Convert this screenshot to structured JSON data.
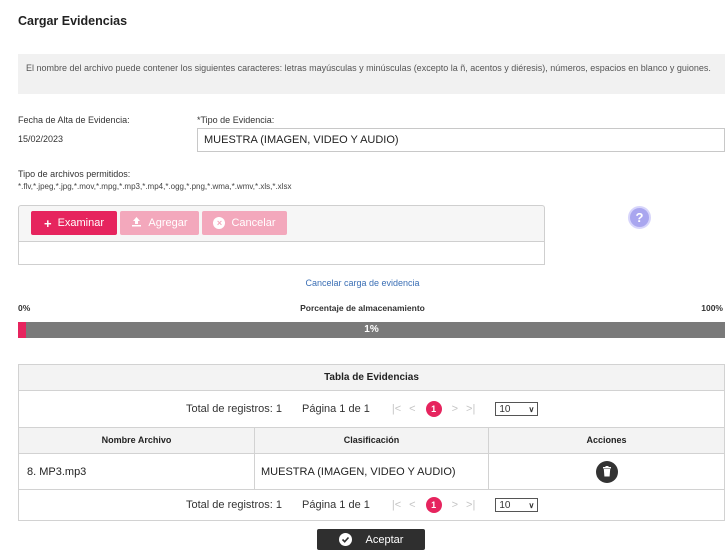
{
  "title": "Cargar Evidencias",
  "info_text": "El nombre del archivo puede contener los siguientes caracteres: letras mayúsculas y minúsculas (excepto la ñ, acentos y diéresis), números, espacios en blanco y guiones.",
  "fecha": {
    "label": "Fecha de Alta de Evidencia:",
    "value": "15/02/2023"
  },
  "tipo": {
    "label": "*Tipo de Evidencia:",
    "value": "MUESTRA (IMAGEN, VIDEO Y AUDIO)"
  },
  "allowed": {
    "label": "Tipo de archivos permitidos:",
    "value": "*.flv,*.jpeg,*.jpg,*.mov,*.mpg,*.mp3,*.mp4,*.ogg,*.png,*.wma,*.wmv,*.xls,*.xlsx"
  },
  "buttons": {
    "examinar": "Examinar",
    "agregar": "Agregar",
    "cancelar": "Cancelar",
    "aceptar": "Aceptar"
  },
  "icons": {
    "help": "?"
  },
  "cancel_link": "Cancelar carga de evidencia",
  "storage": {
    "left": "0%",
    "label": "Porcentaje de almacenamiento",
    "right": "100%",
    "percent_text": "1%",
    "fill_fraction": 0.012
  },
  "table": {
    "title": "Tabla de Evidencias",
    "pager": {
      "total": "Total de registros: 1",
      "page": "Página 1 de 1",
      "first": "|<",
      "prev": "<",
      "current": "1",
      "next": ">",
      "last": ">|",
      "size": "10"
    },
    "columns": [
      "Nombre Archivo",
      "Clasificación",
      "Acciones"
    ],
    "rows": [
      {
        "nombre": "8. MP3.mp3",
        "clasificacion": "MUESTRA (IMAGEN, VIDEO Y AUDIO)"
      }
    ]
  },
  "colors": {
    "accent": "#e6245e",
    "accent_disabled": "#f3a8bc",
    "progress_bg": "#7a7a7a",
    "help": "#a9a6ef"
  }
}
